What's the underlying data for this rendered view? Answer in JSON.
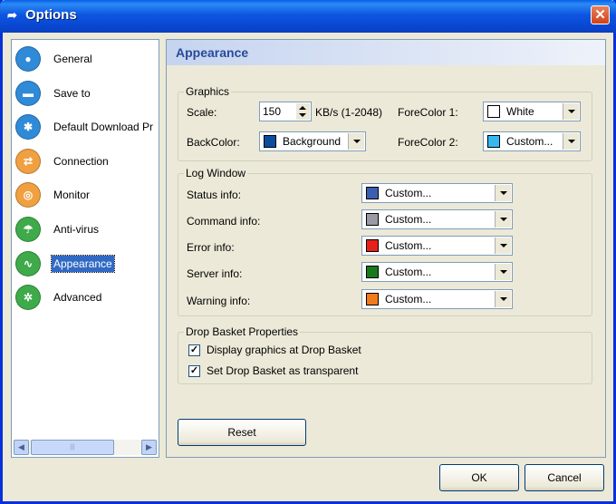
{
  "window": {
    "title": "Options",
    "close_glyph": "✕"
  },
  "sidebar": {
    "items": [
      {
        "label": "General",
        "icon": "user-icon",
        "color": "#2f8ad8",
        "glyph": "●"
      },
      {
        "label": "Save to",
        "icon": "folder-icon",
        "color": "#2f8ad8",
        "glyph": "▬"
      },
      {
        "label": "Default Download Pr",
        "icon": "asterisk-icon",
        "color": "#2f8ad8",
        "glyph": "✱"
      },
      {
        "label": "Connection",
        "icon": "connection-icon",
        "color": "#f0a040",
        "glyph": "⇄"
      },
      {
        "label": "Monitor",
        "icon": "monitor-icon",
        "color": "#f0a040",
        "glyph": "◎"
      },
      {
        "label": "Anti-virus",
        "icon": "umbrella-icon",
        "color": "#3eaa4a",
        "glyph": "☂"
      },
      {
        "label": "Appearance",
        "icon": "appearance-icon",
        "color": "#3eaa4a",
        "glyph": "∿"
      },
      {
        "label": "Advanced",
        "icon": "wheel-icon",
        "color": "#3eaa4a",
        "glyph": "✲"
      }
    ],
    "selected": "Appearance"
  },
  "panel": {
    "title": "Appearance"
  },
  "graphics": {
    "title": "Graphics",
    "scale_label": "Scale:",
    "scale_value": "150",
    "scale_unit": "KB/s (1-2048)",
    "forecolor1_label": "ForeColor 1:",
    "forecolor1_value": "White",
    "forecolor1_color": "#ffffff",
    "backcolor_label": "BackColor:",
    "backcolor_value": "Background",
    "backcolor_color": "#0a4ea0",
    "forecolor2_label": "ForeColor 2:",
    "forecolor2_value": "Custom...",
    "forecolor2_color": "#36b8f0"
  },
  "log_window": {
    "title": "Log Window",
    "rows": [
      {
        "label": "Status info:",
        "value": "Custom...",
        "color": "#3a5fb0"
      },
      {
        "label": "Command info:",
        "value": "Custom...",
        "color": "#9a9aa6"
      },
      {
        "label": "Error info:",
        "value": "Custom...",
        "color": "#e8201a"
      },
      {
        "label": "Server info:",
        "value": "Custom...",
        "color": "#167a1c"
      },
      {
        "label": "Warning info:",
        "value": "Custom...",
        "color": "#f07a1c"
      }
    ]
  },
  "drop_basket": {
    "title": "Drop Basket Properties",
    "options": [
      {
        "label": "Display graphics at Drop Basket",
        "checked": true,
        "mark": "✓"
      },
      {
        "label": "Set Drop Basket as transparent",
        "checked": true,
        "mark": "✓"
      }
    ]
  },
  "buttons": {
    "reset": "Reset",
    "ok": "OK",
    "cancel": "Cancel"
  }
}
